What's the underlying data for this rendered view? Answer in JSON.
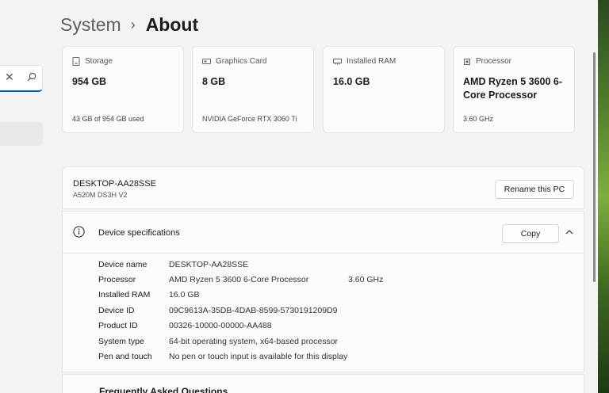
{
  "breadcrumb": {
    "parent": "System",
    "separator": "›",
    "current": "About"
  },
  "cards": [
    {
      "title": "Storage",
      "value": "954 GB",
      "sub": "43 GB of 954 GB used"
    },
    {
      "title": "Graphics Card",
      "value": "8 GB",
      "sub": "NVIDIA GeForce RTX 3060 Ti"
    },
    {
      "title": "Installed RAM",
      "value": "16.0 GB",
      "sub": ""
    },
    {
      "title": "Processor",
      "value": "AMD Ryzen 5 3600 6-Core Processor",
      "sub": "3.60 GHz"
    }
  ],
  "pc": {
    "name": "DESKTOP-AA28SSE",
    "model": "A520M DS3H V2",
    "rename_label": "Rename this PC"
  },
  "specs": {
    "title": "Device specifications",
    "copy_label": "Copy",
    "rows": [
      {
        "label": "Device name",
        "value": "DESKTOP-AA28SSE",
        "extra": ""
      },
      {
        "label": "Processor",
        "value": "AMD Ryzen 5 3600 6-Core Processor",
        "extra": "3.60 GHz"
      },
      {
        "label": "Installed RAM",
        "value": "16.0 GB",
        "extra": ""
      },
      {
        "label": "Device ID",
        "value": "09C9613A-35DB-4DAB-8599-5730191209D9",
        "extra": ""
      },
      {
        "label": "Product ID",
        "value": "00326-10000-00000-AA488",
        "extra": ""
      },
      {
        "label": "System type",
        "value": "64-bit operating system, x64-based processor",
        "extra": ""
      },
      {
        "label": "Pen and touch",
        "value": "No pen or touch input is available for this display",
        "extra": ""
      }
    ]
  },
  "faq": {
    "title": "Frequently Asked Questions"
  },
  "sidebar": {
    "search_clear": "✕"
  },
  "colors": {
    "accent": "#0067c0",
    "background": "#f3f3f3",
    "card": "#fbfbfb"
  }
}
